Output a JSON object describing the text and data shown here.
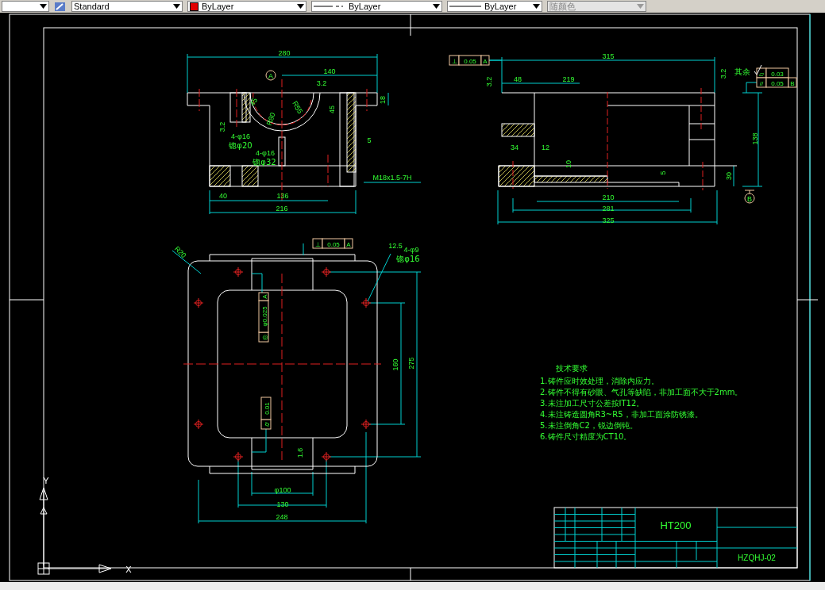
{
  "toolbar": {
    "combos": [
      {
        "kind": "style",
        "value": "Standard"
      },
      {
        "kind": "color",
        "value": "ByLayer"
      },
      {
        "kind": "linetype",
        "value": "ByLayer"
      },
      {
        "kind": "lineweight",
        "value": "ByLayer"
      },
      {
        "kind": "plotstyle",
        "value": "随颜色",
        "disabled": true
      }
    ]
  },
  "front_view": {
    "datum": "A",
    "labels": [
      {
        "text": "280"
      },
      {
        "text": "140"
      },
      {
        "text": "3.2"
      },
      {
        "text": "18"
      },
      {
        "text": "R55"
      },
      {
        "text": "R80"
      },
      {
        "text": "45"
      },
      {
        "text": "45"
      },
      {
        "text": "3.2"
      },
      {
        "text": "4-φ16"
      },
      {
        "text": "锪φ20"
      },
      {
        "text": "4-φ16"
      },
      {
        "text": "锪φ32"
      },
      {
        "text": "5"
      },
      {
        "text": "M18x1.5-7H"
      },
      {
        "text": "40"
      },
      {
        "text": "136"
      },
      {
        "text": "216"
      }
    ]
  },
  "side_view": {
    "datum": "B",
    "labels": [
      {
        "text": "315"
      },
      {
        "text": "3.2"
      },
      {
        "text": "48"
      },
      {
        "text": "219"
      },
      {
        "text": "3.2"
      },
      {
        "text": "34"
      },
      {
        "text": "12"
      },
      {
        "text": "10"
      },
      {
        "text": "5"
      },
      {
        "text": "30"
      },
      {
        "text": "138"
      },
      {
        "text": "210"
      },
      {
        "text": "281"
      },
      {
        "text": "325"
      }
    ]
  },
  "top_view": {
    "labels": [
      {
        "text": "R20"
      },
      {
        "text": "12.5"
      },
      {
        "text": "4-φ9"
      },
      {
        "text": "锪φ16"
      },
      {
        "text": "160"
      },
      {
        "text": "275"
      },
      {
        "text": "1.6"
      },
      {
        "text": "φ100"
      },
      {
        "text": "130"
      },
      {
        "text": "248"
      }
    ]
  },
  "tolerance_frames": [
    {
      "cells": [
        "⊥",
        "0.05",
        "A"
      ]
    },
    {
      "cells": [
        "⊥",
        "0.05",
        "A"
      ]
    },
    {
      "cells": [
        "◎",
        "φ0.025",
        "A"
      ]
    },
    {
      "cells": [
        "⌭",
        "0.01"
      ]
    },
    {
      "cells": [
        "⏥",
        "0.03"
      ]
    },
    {
      "cells": [
        "//",
        "0.05",
        "B"
      ]
    }
  ],
  "roughness_note": "其余",
  "technical_requirements": {
    "heading": "技术要求",
    "lines": [
      "1.铸件应时效处理，消除内应力。",
      "2.铸件不得有砂眼、气孔等缺陷，非加工面不大于2mm。",
      "3.未注加工尺寸公差按IT12。",
      "4.未注铸造圆角R3~R5，非加工面涂防锈漆。",
      "5.未注倒角C2，锐边倒钝。",
      "6.铸件尺寸精度为CT10。"
    ]
  },
  "title_block": {
    "material": "HT200",
    "drawing_number": "HZQHJ-02"
  },
  "ucs": {
    "x_label": "X",
    "y_label": "Y"
  }
}
